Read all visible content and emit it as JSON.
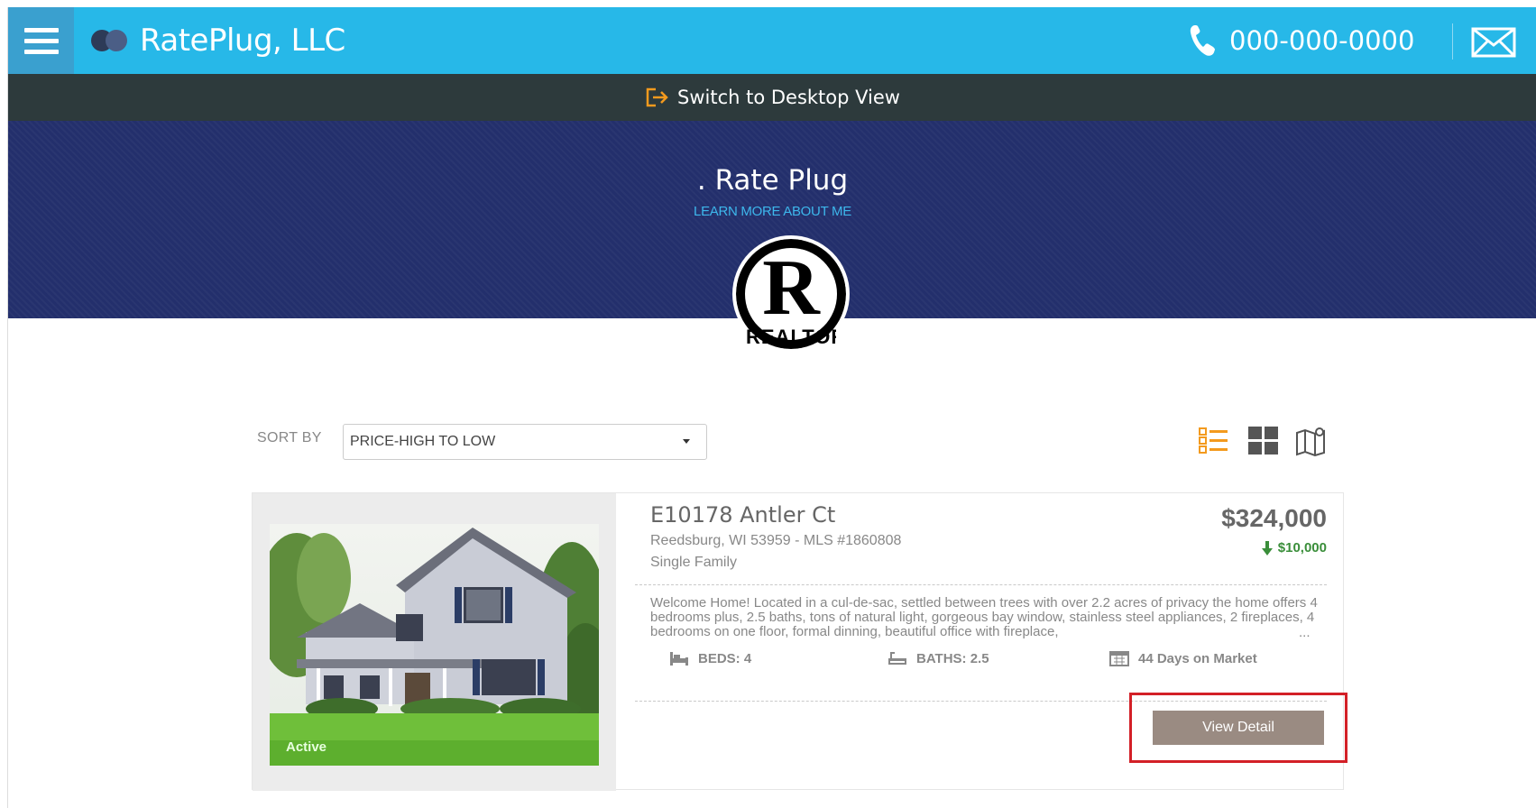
{
  "header": {
    "brand_name": "RatePlug, LLC",
    "phone": "000-000-0000",
    "accent_color": "#27b8e8"
  },
  "switch_bar": {
    "label": "Switch to Desktop View"
  },
  "hero": {
    "title": ". Rate Plug",
    "link": "LEARN MORE ABOUT ME",
    "badge_letter": "R",
    "badge_text": "REALTOR",
    "background_color": "#232f6c"
  },
  "sort": {
    "label": "SORT BY",
    "selected": "PRICE-HIGH TO LOW"
  },
  "view_modes": [
    "list-view-icon",
    "grid-view-icon",
    "map-view-icon"
  ],
  "listing": {
    "address": "E10178 Antler Ct",
    "city_line": "Reedsburg, WI 53959 - MLS #1860808",
    "property_type": "Single Family",
    "price": "$324,000",
    "price_change": "$10,000",
    "description": "Welcome Home! Located in a cul-de-sac, settled between trees with over 2.2 acres of privacy the home offers 4 bedrooms plus, 2.5 baths, tons of natural light, gorgeous bay window, stainless steel appliances, 2 fireplaces, 4 bedrooms on one floor, formal dinning, beautiful office with fireplace,",
    "description_more": "...",
    "beds": "BEDS: 4",
    "baths": "BATHS: 2.5",
    "days_on_market": "44 Days on Market",
    "status": "Active",
    "detail_button": "View Detail"
  }
}
